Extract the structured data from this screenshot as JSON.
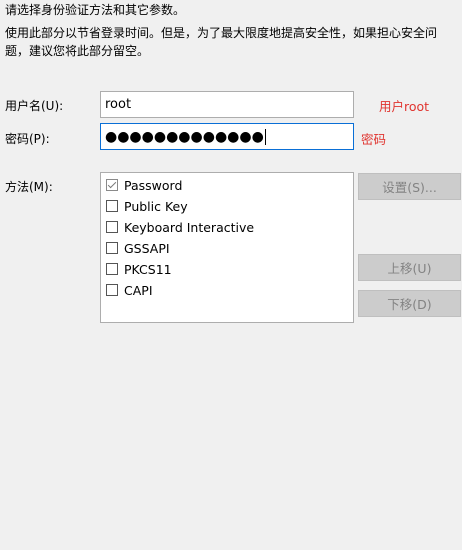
{
  "intro": {
    "line1": "请选择身份验证方法和其它参数。",
    "line2": "使用此部分以节省登录时间。但是，为了最大限度地提高安全性，如果担心安全问题，建议您将此部分留空。"
  },
  "username": {
    "label": "用户名(U):",
    "value": "root",
    "annotation": "用户root"
  },
  "password": {
    "label": "密码(P):",
    "masked_value": "●●●●●●●●●●●●●",
    "annotation": "密码"
  },
  "method": {
    "label": "方法(M):",
    "items": [
      {
        "label": "Password",
        "checked": true
      },
      {
        "label": "Public Key",
        "checked": false
      },
      {
        "label": "Keyboard Interactive",
        "checked": false
      },
      {
        "label": "GSSAPI",
        "checked": false
      },
      {
        "label": "PKCS11",
        "checked": false
      },
      {
        "label": "CAPI",
        "checked": false
      }
    ]
  },
  "buttons": {
    "settings": "设置(S)...",
    "move_up": "上移(U)",
    "move_down": "下移(D)"
  }
}
